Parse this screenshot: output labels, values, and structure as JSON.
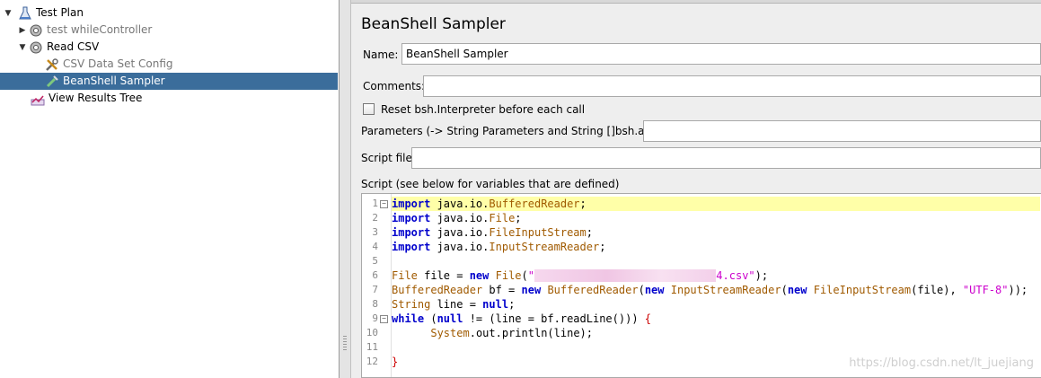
{
  "tree": {
    "items": [
      {
        "label": "Test Plan",
        "toggle": "▼",
        "icon": "flask-icon",
        "dimmed": false,
        "selected": false
      },
      {
        "label": "test whileController",
        "toggle": "▶",
        "icon": "gear-icon",
        "dimmed": true,
        "selected": false
      },
      {
        "label": "Read CSV",
        "toggle": "▼",
        "icon": "gear-icon",
        "dimmed": false,
        "selected": false
      },
      {
        "label": "CSV Data Set Config",
        "toggle": "",
        "icon": "wrench-icon",
        "dimmed": true,
        "selected": false
      },
      {
        "label": "BeanShell Sampler",
        "toggle": "",
        "icon": "pipette-icon",
        "dimmed": false,
        "selected": true
      },
      {
        "label": "View Results Tree",
        "toggle": "",
        "icon": "chart-icon",
        "dimmed": false,
        "selected": false
      }
    ]
  },
  "sampler": {
    "title": "BeanShell Sampler",
    "name_label": "Name:",
    "name_value": "BeanShell Sampler",
    "comments_label": "Comments:",
    "comments_value": "",
    "reset_label": "Reset bsh.Interpreter before each call",
    "reset_checked": false,
    "parameters_label": "Parameters (-> String Parameters and String []bsh.args)",
    "parameters_value": "",
    "script_file_label": "Script file",
    "script_file_value": "",
    "script_label": "Script (see below for variables that are defined)"
  },
  "script": {
    "line_numbers": [
      "1",
      "2",
      "3",
      "4",
      "5",
      "6",
      "7",
      "8",
      "9",
      "10",
      "11",
      "12"
    ],
    "lines": [
      "import java.io.BufferedReader;",
      "import java.io.File;",
      "import java.io.FileInputStream;",
      "import java.io.InputStreamReader;",
      "",
      "File file = new File(\"4.csv\");",
      "BufferedReader bf = new BufferedReader(new InputStreamReader(new FileInputStream(file), \"UTF-8\"));",
      "String line = null;",
      "while (null != (line = bf.readLine())) {",
      "      System.out.println(line);",
      "",
      "}"
    ],
    "highlighted_line": 1
  },
  "watermark": "https://blog.csdn.net/lt_juejiang",
  "colors": {
    "selection": "#3b6d9b",
    "keyword": "#0000cc",
    "type": "#a05a00",
    "string": "#cc00cc",
    "current_line": "#ffffa8"
  }
}
